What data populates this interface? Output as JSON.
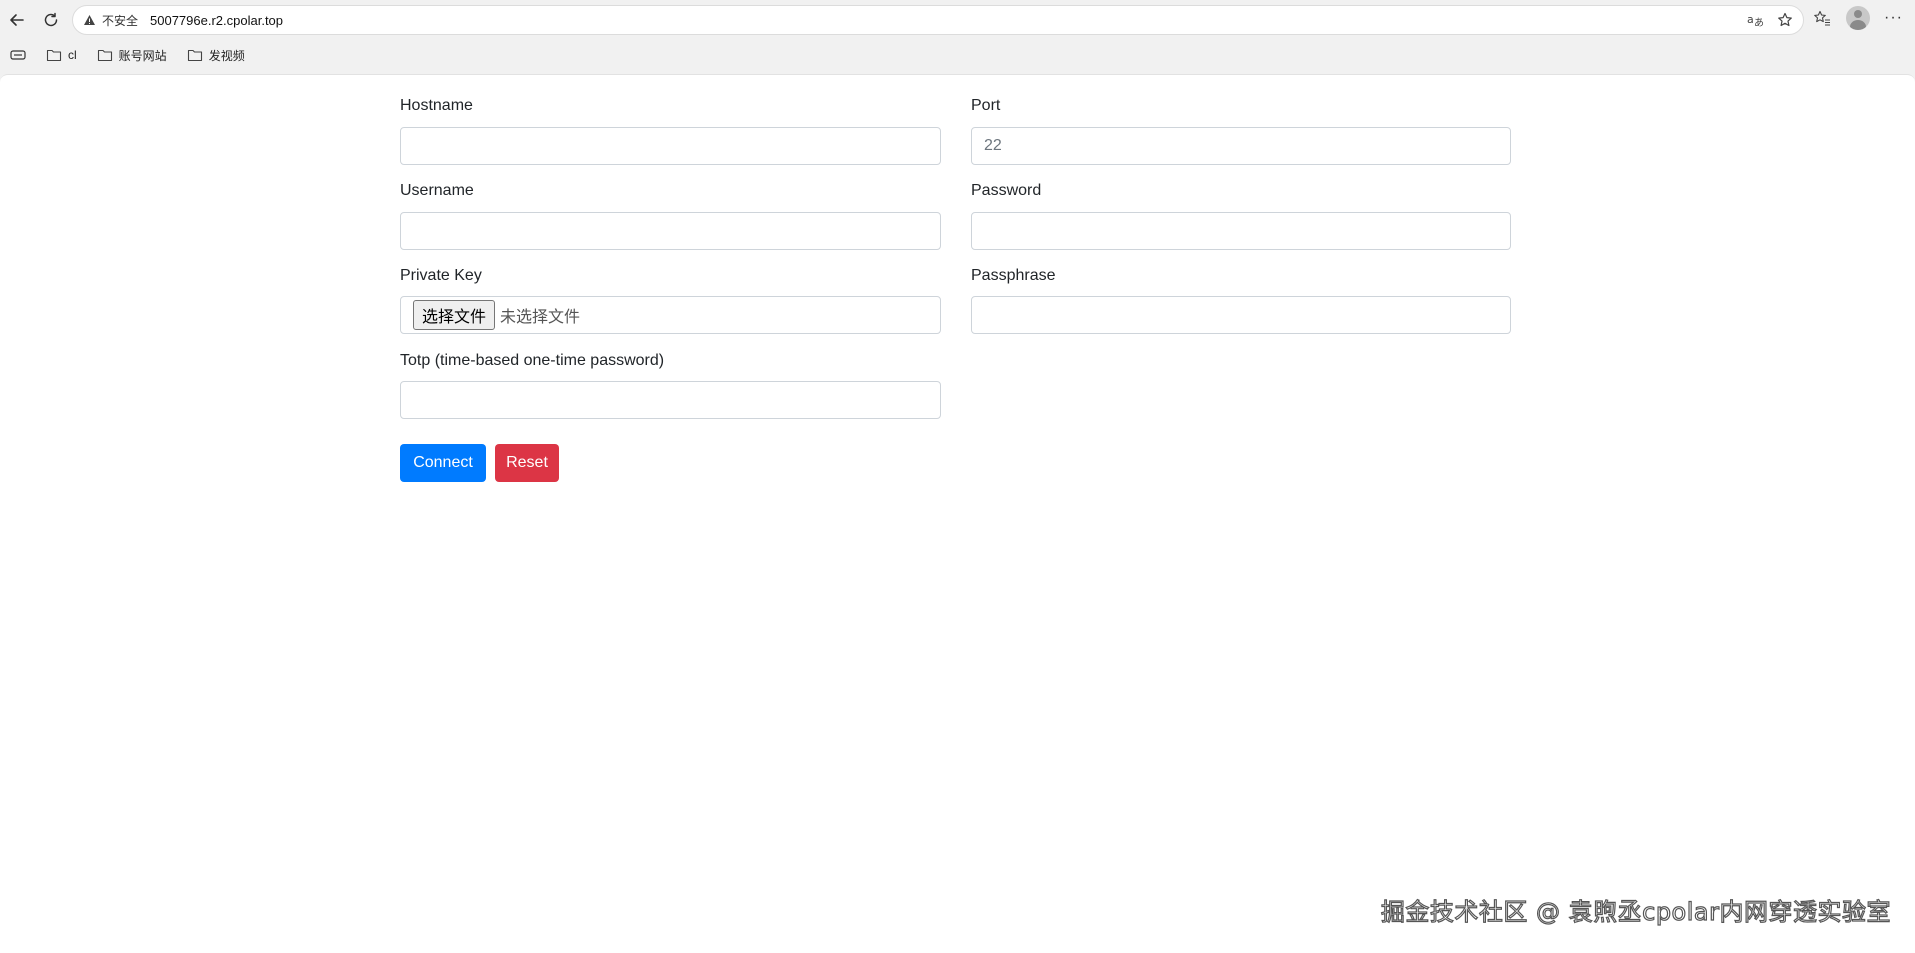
{
  "browser": {
    "security_label": "不安全",
    "url": "5007796e.r2.cpolar.top",
    "icons": {
      "back": "back-arrow-icon",
      "refresh": "refresh-icon",
      "warning": "warning-triangle-icon",
      "translate": "translate-icon",
      "favorite": "star-icon",
      "favorites_bar": "favorites-icon",
      "profile": "profile-avatar-icon",
      "menu": "more-menu-icon"
    },
    "more_label": "···"
  },
  "bookmarks": [
    {
      "label": "cl"
    },
    {
      "label": "账号网站"
    },
    {
      "label": "发视频"
    }
  ],
  "form": {
    "hostname": {
      "label": "Hostname",
      "value": "",
      "placeholder": ""
    },
    "port": {
      "label": "Port",
      "value": "",
      "placeholder": "22"
    },
    "username": {
      "label": "Username",
      "value": "",
      "placeholder": ""
    },
    "password": {
      "label": "Password",
      "value": "",
      "placeholder": ""
    },
    "private_key": {
      "label": "Private Key",
      "button_label": "选择文件",
      "status": "未选择文件"
    },
    "passphrase": {
      "label": "Passphrase",
      "value": "",
      "placeholder": ""
    },
    "totp": {
      "label": "Totp (time-based one-time password)",
      "value": "",
      "placeholder": ""
    },
    "connect_label": "Connect",
    "reset_label": "Reset"
  },
  "colors": {
    "connect": "#007bff",
    "reset": "#dc3545"
  },
  "watermark": "掘金技术社区 @ 袁煦丞cpolar内网穿透实验室"
}
